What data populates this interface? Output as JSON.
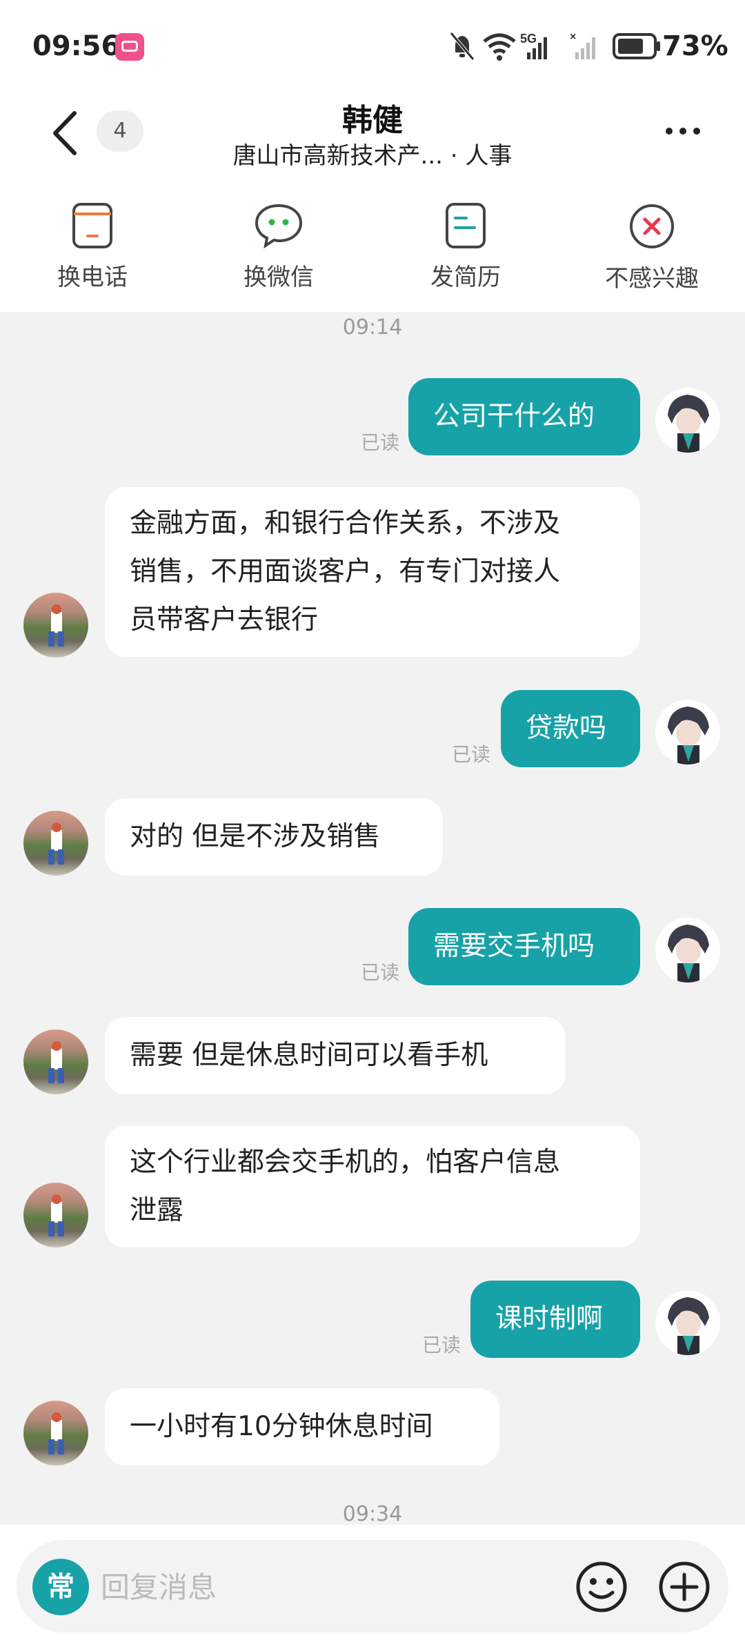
{
  "status_bar": {
    "time": "09:56",
    "app_badge_icon": "bilibili-icon",
    "icons": [
      "mute-bell-icon",
      "wifi-icon",
      "5g-signal-icon",
      "no-signal-icon",
      "battery-icon"
    ],
    "battery": "73%"
  },
  "header": {
    "back_icon": "chevron-left-icon",
    "unread_count": "4",
    "name": "韩健",
    "subtitle": "唐山市高新技术产... · 人事",
    "more_icon": "more-icon"
  },
  "actions": [
    {
      "label": "换电话",
      "icon": "phone-icon"
    },
    {
      "label": "换微信",
      "icon": "wechat-icon"
    },
    {
      "label": "发简历",
      "icon": "resume-icon"
    },
    {
      "label": "不感兴趣",
      "icon": "close-circle-icon"
    }
  ],
  "chat": {
    "timestamp_top": "09:14",
    "timestamp_bottom": "09:34",
    "read_label": "已读",
    "messages": [
      {
        "from": "me",
        "text": "公司干什么的"
      },
      {
        "from": "hr",
        "lines": [
          "金融方面，和银行合作关系，不涉及",
          "销售，不用面谈客户，有专门对接人",
          "员带客户去银行"
        ]
      },
      {
        "from": "me",
        "text": "贷款吗"
      },
      {
        "from": "hr",
        "text": "对的  但是不涉及销售"
      },
      {
        "from": "me",
        "text": "需要交手机吗"
      },
      {
        "from": "hr",
        "text": "需要  但是休息时间可以看手机"
      },
      {
        "from": "hr",
        "lines": [
          "这个行业都会交手机的，怕客户信息",
          "泄露"
        ]
      },
      {
        "from": "me",
        "text": "课时制啊"
      },
      {
        "from": "hr",
        "text": "一小时有10分钟休息时间"
      }
    ]
  },
  "input_bar": {
    "common_label": "常",
    "placeholder": "回复消息",
    "emoji_icon": "emoji-icon",
    "plus_icon": "plus-icon"
  },
  "colors": {
    "accent": "#17a2a8",
    "background": "#f2f2f2",
    "bubble_in": "#ffffff",
    "danger": "#e8384f",
    "orange": "#f07a3c"
  }
}
